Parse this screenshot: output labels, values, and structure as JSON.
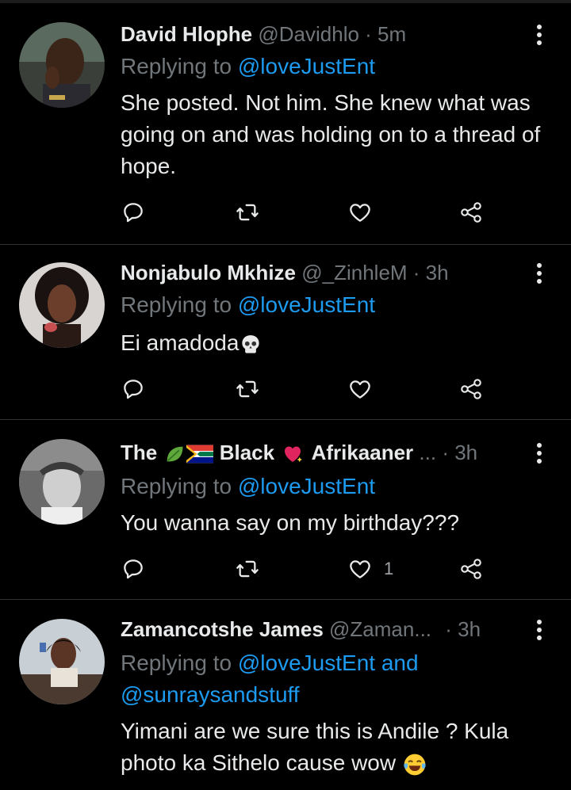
{
  "tweets": [
    {
      "name": "David Hlophe",
      "handle": "@Davidhlo",
      "time": "· 5m",
      "replying_prefix": "Replying to ",
      "replying_to": "@loveJustEnt",
      "text": "She posted. Not him. She knew what was going on and was holding on to a thread of hope.",
      "likes": ""
    },
    {
      "name": "Nonjabulo Mkhize",
      "handle": "@_ZinhleM",
      "time": "· 3h",
      "replying_prefix": "Replying to ",
      "replying_to": "@loveJustEnt",
      "text": "Ei amadoda",
      "likes": ""
    },
    {
      "name_part1": "The",
      "name_part2": "Black",
      "name_part3": "Afrikaaner",
      "ellipsis": "...",
      "time": "· 3h",
      "replying_prefix": "Replying to ",
      "replying_to": "@loveJustEnt",
      "text": "You wanna say on my birthday???",
      "likes": "1"
    },
    {
      "name": "Zamancotshe James",
      "handle": "@Zaman...",
      "time": "· 3h",
      "replying_prefix": "Replying to ",
      "replying_to": "@loveJustEnt and",
      "replying_to_2": "@sunraysandstuff",
      "text": "Yimani are we sure this is Andile ? Kula photo ka Sithelo cause wow",
      "likes": ""
    }
  ],
  "icons": [
    "reply-icon",
    "retweet-icon",
    "like-icon",
    "share-icon",
    "more-icon"
  ],
  "colors": {
    "background": "#000000",
    "text": "#e7e9ea",
    "muted": "#71767b",
    "link": "#1d9bf0",
    "divider": "#2f3336"
  }
}
